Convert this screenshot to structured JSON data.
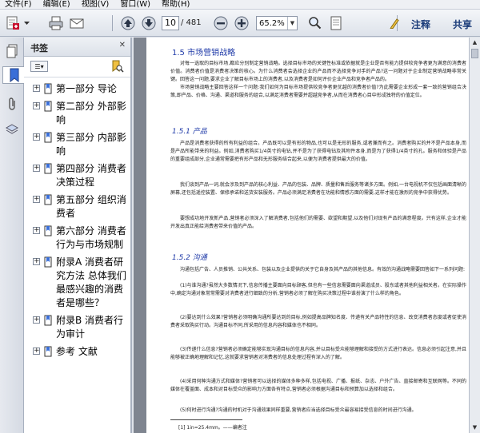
{
  "menu": [
    "文件(F)",
    "编辑(E)",
    "视图(V)",
    "窗口(W)",
    "帮助(H)"
  ],
  "toolbar": {
    "page_current": "10",
    "page_total": "/ 481",
    "zoom": "65.2%",
    "annotate_label": "注释",
    "share_label": "共享",
    "icons": [
      "create-pdf-icon",
      "print-icon",
      "email-icon",
      "prev-page-icon",
      "next-page-icon",
      "zoom-out-icon",
      "zoom-in-icon",
      "find-icon",
      "fit-page-icon"
    ]
  },
  "sidebar": {
    "title": "书签",
    "items": [
      {
        "label": "第一部分 导论"
      },
      {
        "label": "第二部分 外部影响"
      },
      {
        "label": "第三部分 内部影响"
      },
      {
        "label": "第四部分 消费者决策过程"
      },
      {
        "label": "第五部分 组织消费者"
      },
      {
        "label": "第六部分 消费者行为与市场规制"
      },
      {
        "label": "附录A 消费者研究方法 总体我们最感兴趣的消费者是哪些？"
      },
      {
        "label": "附录B 消费者行为审计"
      },
      {
        "label": "参考 文献"
      }
    ]
  },
  "doc": {
    "h1": "1.5   市场营销战略",
    "p1": "对每一选取的目标市场,都应分别制定营销战略。选择目标市场的关键性标准或依据就是企业是否有能力提供较竞争者更为满意的消费者价值。消费者价值是消费者决策的核心。为什么消费者会选择企业的产品而不选择竞争对手的产品?这一问题对于企业制定营销战略非常关键。回答这一问题,要求企业了解目标市场上的消费者,以及消费者是如何评价企业产品和竞争者产品的。",
    "p2": "市场营销战略主要回答这样一个问题:我们如何为目标市场提供较竞争者更优越的消费者价值?为此需要企业形成一套一致的营销组合决策,即产品、价格、沟通、渠道和服务的组合,以满足消费者需要并超越竞争者,从而在消费者心目中形成独特的价值定位。",
    "h2a": "1.5.1   产品",
    "p3": "产品是消费者获得的所有利益的组合。产品既可以是有形的物品,也可以是无形的服务,或者兼而有之。消费者购买的并不是产品本身,而是产品所能带来的利益。例如,消费者购买1/4英寸的电钻,并不是为了获得电钻及其附件本身,而是为了获得1/4英寸的孔。服务和体验是产品的重要组成部分,企业通常需要把有形产品和无形服务结合起来,以便为消费者提供最大的价值。",
    "p4": "我们谈到产品一词,就会涉及到产品的核心利益、产品的包装、品牌、质量和售后服务等诸多方面。例如,一台电视机不仅包括画面清晰的屏幕,还包括遥控装置、保修承诺和送货安装服务。产品必须满足消费者在功能和情感方面的需要,这样才能在激烈的竞争中获得优势。",
    "p5": "要想成功地开发新产品,营销者必须深入了解消费者,包括他们的需要、欲望和期望,以及他们对现有产品的满意程度。只有这样,企业才能开发出真正能给消费者带来价值的产品。",
    "h2b": "1.5.2   沟通",
    "p6": "沟通包括广告、人员推销、公共关系、包装以及企业提供的关于它自身及其产品的其他信息。有效的沟通战略需要回答如下一系列问题:",
    "p7": "(1)与谁沟通?虽然大多数情况下,信息传播主要面向目标顾客,但也有一些信息需要面向渠道成员、股东或者其他利益相关者。在实际操作中,确定沟通对象常常需要对消费者进行细致的分析,营销者必须了解在购买决策过程中谁扮演了什么样的角色。",
    "p8": "(2)要达到什么效果?营销者必须明确沟通所要达到的目标,例如提高品牌知名度、传递有关产品特性的信息、改变消费者态度或者促使消费者采取购买行动。沟通目标不同,所采用的信息内容和媒体也不相同。",
    "p9": "(3)传递什么信息?营销者必须确定能够实现沟通目标的信息内容,并以目标受众能够理解和接受的方式进行表达。信息必须引起注意,并且能够被正确地理解和记忆,这就要求营销者对消费者的信息处理过程有深入的了解。",
    "p10": "(4)采用何种沟通方式和媒体?营销者可以选择的媒体多种多样,包括电视、广播、报纸、杂志、户外广告、直接邮寄和互联网等。不同的媒体在覆盖面、成本和对目标受众的影响力方面各有特点,营销者必须根据沟通目标和预算加以选择和组合。",
    "p11": "(5)何时进行沟通?沟通的时机对于沟通效果同样重要,营销者应当选择目标受众最容易接受信息的时间进行沟通。",
    "footnote": "[1]  1in=25.4mm。——编者注"
  }
}
